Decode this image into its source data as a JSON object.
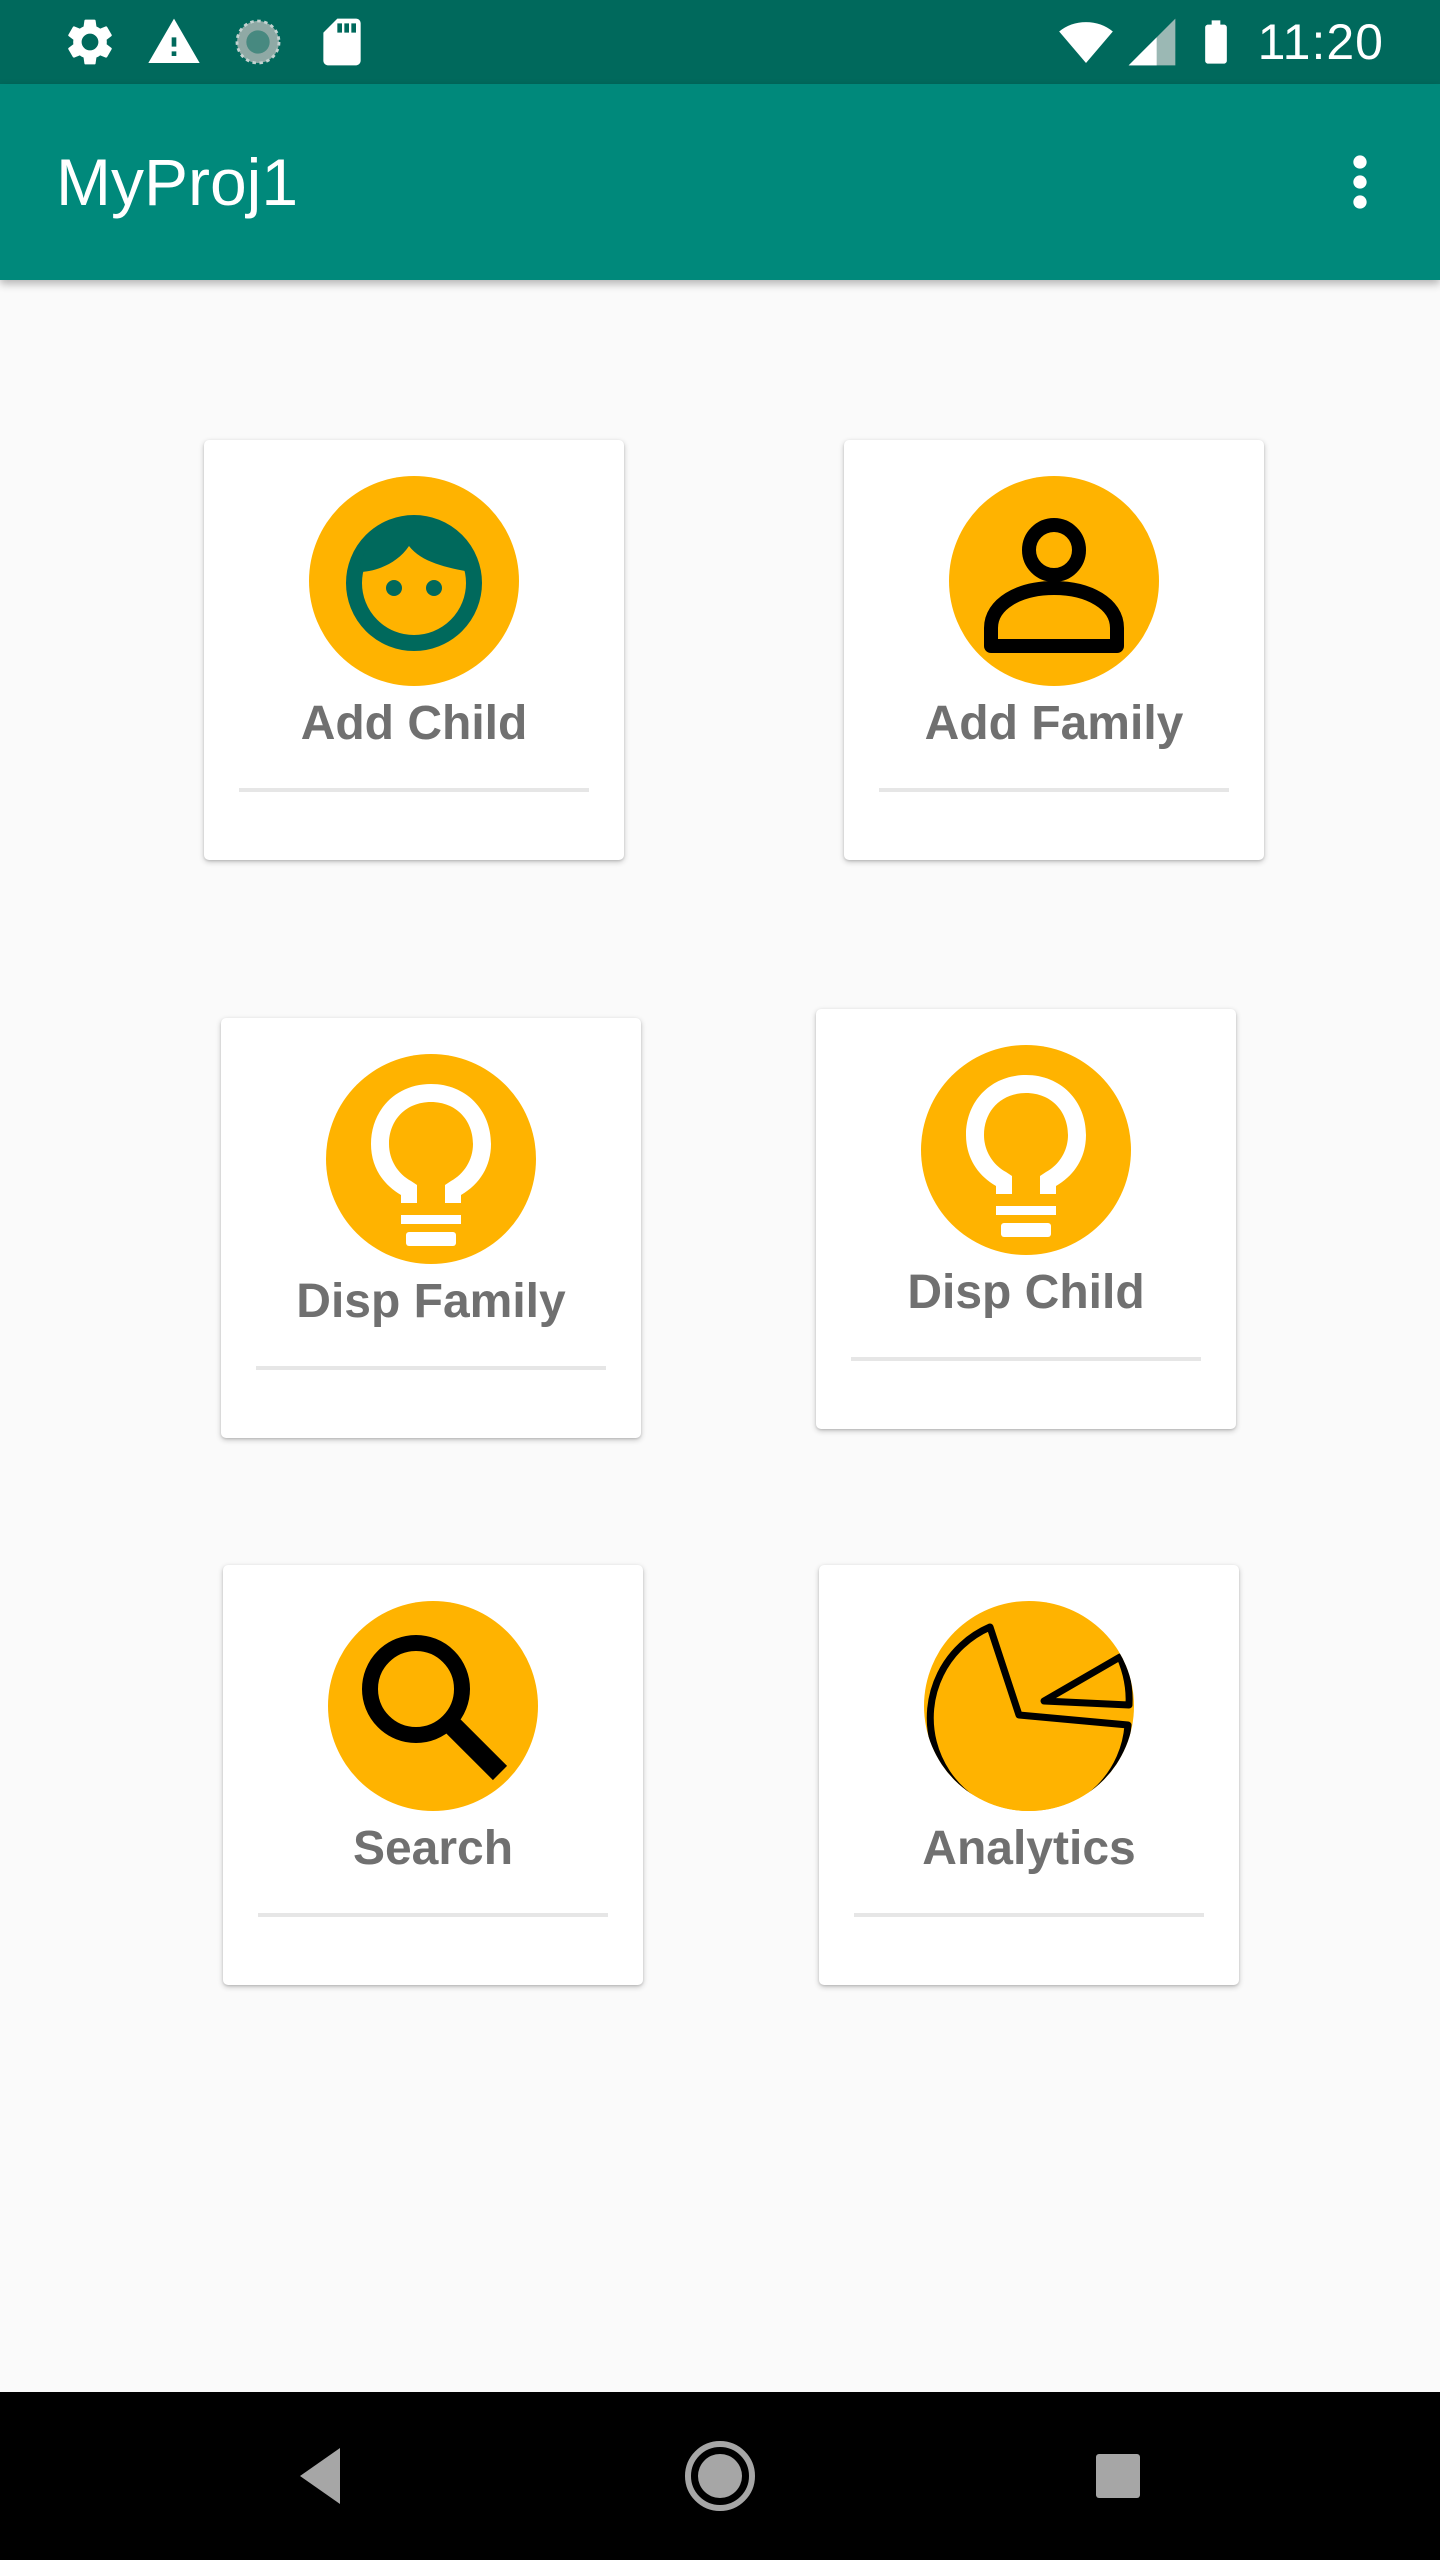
{
  "status_bar": {
    "time": "11:20",
    "left_icons": [
      "settings-icon",
      "warning-icon",
      "loading-icon",
      "sd-card-icon"
    ],
    "right_icons": [
      "wifi-icon",
      "cell-signal-icon",
      "battery-icon"
    ]
  },
  "app_bar": {
    "title": "MyProj1",
    "overflow_icon": "more-vert-icon"
  },
  "menu": {
    "items": [
      {
        "label": "Add Child",
        "icon": "child-face-icon"
      },
      {
        "label": "Add Family",
        "icon": "person-icon"
      },
      {
        "label": "Disp Family",
        "icon": "lightbulb-icon"
      },
      {
        "label": "Disp Child",
        "icon": "lightbulb-icon"
      },
      {
        "label": "Search",
        "icon": "search-icon"
      },
      {
        "label": "Analytics",
        "icon": "pie-chart-icon"
      }
    ]
  },
  "nav_bar": {
    "icons": [
      "back-icon",
      "home-icon",
      "recents-icon"
    ]
  },
  "colors": {
    "status_bar": "#00695c",
    "app_bar": "#00897b",
    "icon_circle": "#ffb300",
    "label_text": "#707070",
    "background": "#fafafa"
  }
}
